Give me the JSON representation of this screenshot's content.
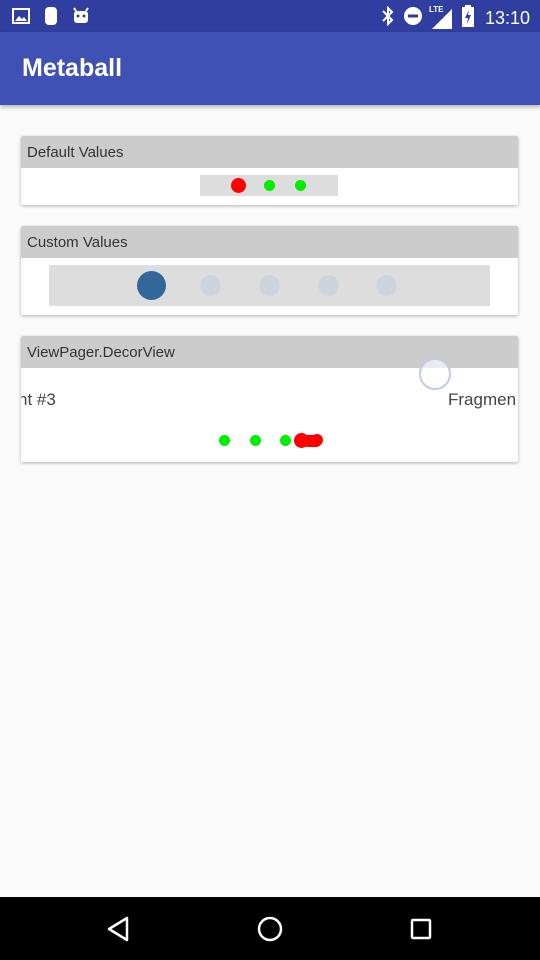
{
  "status_bar": {
    "time": "13:10",
    "network_label": "LTE",
    "left_icons": [
      "image-icon",
      "sd-card-icon",
      "android-icon"
    ],
    "right_icons": [
      "bluetooth-icon",
      "do-not-disturb-icon",
      "signal-icon",
      "battery-charging-icon"
    ]
  },
  "app_bar": {
    "title": "Metaball"
  },
  "cards": {
    "default": {
      "header": "Default Values"
    },
    "custom": {
      "header": "Custom Values"
    },
    "decor": {
      "header": "ViewPager.DecorView",
      "page_left_text": "nt #3",
      "page_right_text": "Fragmen"
    }
  },
  "colors": {
    "primary": "#3f51b5",
    "primary_dark": "#303f9f",
    "indicator_red": "#ff0000",
    "indicator_green": "#00ee00",
    "custom_selected": "#336699",
    "custom_unselected": "#ccd5de"
  }
}
